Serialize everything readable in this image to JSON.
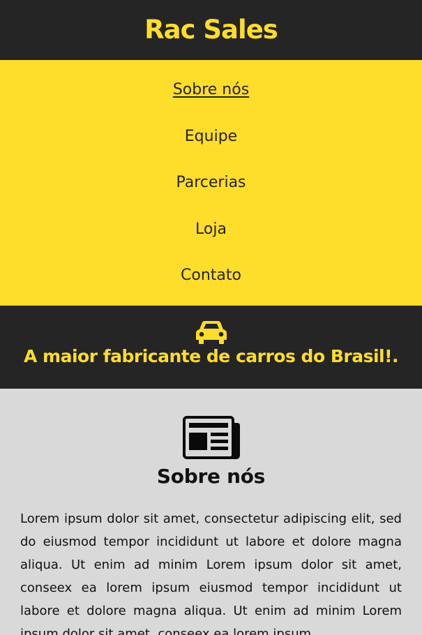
{
  "header": {
    "brand": "Rac Sales"
  },
  "nav": {
    "items": [
      {
        "label": "Sobre nós"
      },
      {
        "label": "Equipe"
      },
      {
        "label": "Parcerias"
      },
      {
        "label": "Loja"
      },
      {
        "label": "Contato"
      }
    ]
  },
  "hero": {
    "icon": "car-icon",
    "title": "A maior fabricante de carros do Brasil!."
  },
  "about": {
    "icon": "newspaper-icon",
    "title": "Sobre nós",
    "text": "Lorem ipsum dolor sit amet, consectetur adipiscing elit, sed do eiusmod tempor incididunt ut labore et dolore magna aliqua. Ut enim ad minim Lorem ipsum dolor sit amet, conseex ea lorem ipsum eiusmod tempor incididunt ut labore et dolore magna aliqua. Ut enim ad minim Lorem ipsum dolor sit amet, conseex ea lorem ipsum"
  },
  "colors": {
    "dark": "#252526",
    "accent": "#ffdd2b",
    "background": "#d9d9d9"
  }
}
